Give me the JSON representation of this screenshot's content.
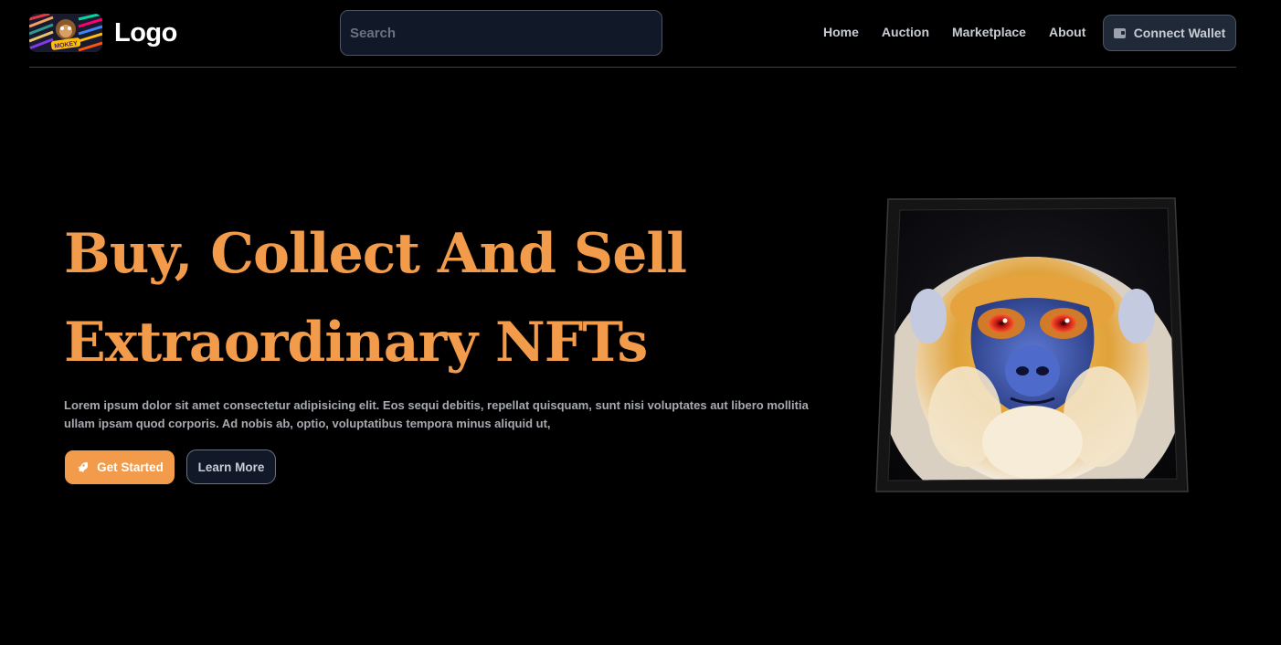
{
  "header": {
    "logo_text": "Logo",
    "logo_badge_text": "MOKEY",
    "search_placeholder": "Search",
    "nav": [
      "Home",
      "Auction",
      "Marketplace",
      "About"
    ],
    "wallet_label": "Connect Wallet"
  },
  "hero": {
    "title_line1": "Buy, Collect And Sell",
    "title_line2": "Extraordinary NFTs",
    "description_line1": "Lorem ipsum dolor sit amet consectetur adipisicing elit. Eos sequi debitis, repellat quisquam, sunt nisi voluptates aut libero mollitia",
    "description_line2": "ullam ipsam quod corporis. Ad nobis ab, optio, voluptatibus tempora minus aliquid ut,",
    "primary_button": "Get Started",
    "secondary_button": "Learn More"
  },
  "colors": {
    "accent": "#f29b4b",
    "background": "#000000",
    "panel": "#111827",
    "border": "#4b5563"
  },
  "icons": {
    "wallet": "wallet-icon",
    "rocket": "rocket-icon"
  }
}
